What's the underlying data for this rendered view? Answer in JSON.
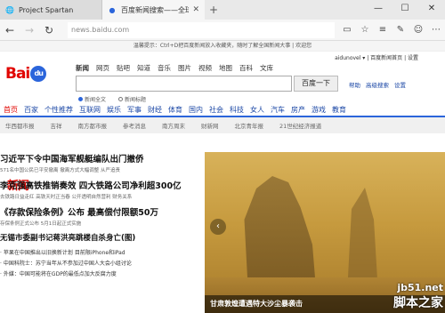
{
  "tabs": [
    {
      "title": "Project Spartan",
      "active": false
    },
    {
      "title": "百度新闻搜索——全球...",
      "active": true
    }
  ],
  "window_controls": {
    "minimize": "—",
    "maximize": "☐",
    "close": "✕"
  },
  "address": {
    "url": "news.baidu.com"
  },
  "notice": "温馨提示：Ctrl+D把百度新闻放入收藏夹，随时了解全国新闻大事 | 欢迎您",
  "top_links": "aidunovel ▾ | 百度新闻首页 | 设置",
  "logo": {
    "bai": "Bai",
    "paw": "du",
    "news": "新闻"
  },
  "search_tabs": [
    "新闻",
    "网页",
    "贴吧",
    "知道",
    "音乐",
    "图片",
    "视频",
    "地图",
    "百科",
    "文库"
  ],
  "search": {
    "button": "百度一下",
    "links": [
      "帮助",
      "高级搜索",
      "设置"
    ]
  },
  "search_options": [
    "新闻全文",
    "新闻标题"
  ],
  "channels": [
    "首页",
    "百家",
    "个性推荐",
    "互联网",
    "娱乐",
    "军事",
    "财经",
    "体育",
    "国内",
    "社会",
    "科技",
    "女人",
    "汽车",
    "房产",
    "游戏",
    "教育"
  ],
  "sub_channels": [
    "华西都市报",
    "吉祥",
    "南方都市报",
    "参考消息",
    "南方周末",
    "财新网",
    "北京青年报",
    "21世纪经济报道"
  ],
  "news": [
    {
      "headline": "习近平下令中国海军舰艇编队出门撤侨",
      "sub": "571名中国公民已平安撤离  撤离方式大幅调整  从严追责"
    },
    {
      "headline": "李克强高铁推销奏效 四大铁路公司净利超300亿",
      "sub": "去铁路日益走红  高铁天时正当春  公开透明自然营利  财务关系"
    },
    {
      "headline": "《存款保险条例》公布 最高偿付限额50万",
      "sub": "存保条例正式公布  5月1日起正式实施"
    },
    {
      "headline": "无锡市委副书记蒋洪亮跳楼自杀身亡(图)",
      "sub": ""
    }
  ],
  "bullets": [
    "苹果在中国推出以旧换新计划 目前限iPhone和iPad",
    "中国科院士：苏宁当年从不参加过中国人大会小组讨论",
    "外媒：中国可能将在GDP的最低点加大反腐力度"
  ],
  "hero": {
    "caption": "甘肃敦煌遭遇特大沙尘暴袭击"
  },
  "watermark": {
    "line1": "jb51.net",
    "line2": "脚本之家"
  }
}
